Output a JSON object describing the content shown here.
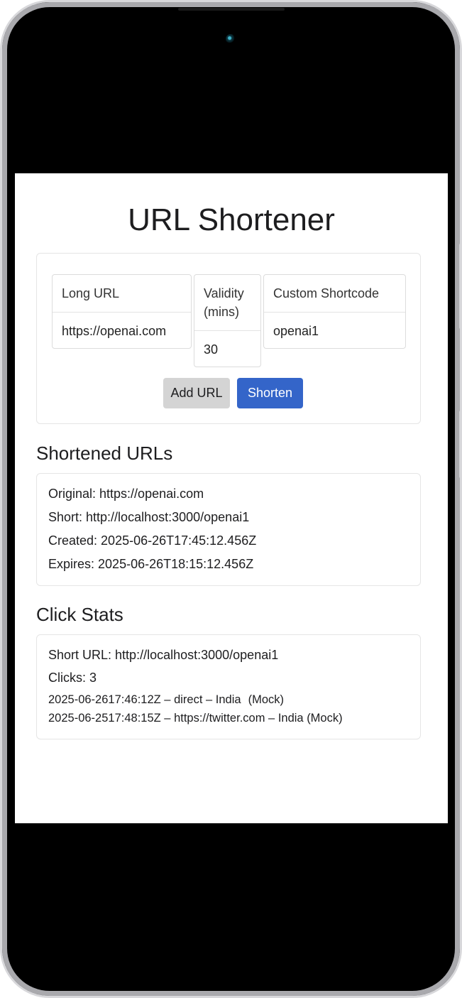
{
  "app": {
    "title": "URL Shortener"
  },
  "form": {
    "fields": [
      {
        "label": "Long URL",
        "value": "https://openai.com"
      },
      {
        "label": "Validity (mins)",
        "value": "30"
      },
      {
        "label": "Custom Shortcode",
        "value": "openai1"
      }
    ],
    "add_button_label": "Add URL",
    "shorten_button_label": "Shorten"
  },
  "shortened": {
    "heading": "Shortened URLs",
    "entry": {
      "original_label": "Original:",
      "original_value": "https://openai.com",
      "short_label": "Short:",
      "short_value": "http://localhost:3000/openai1",
      "created_label": "Created:",
      "created_value": "2025-06-26T17:45:12.456Z",
      "expires_label": "Expires:",
      "expires_value": "2025-06-26T18:15:12.456Z"
    }
  },
  "stats": {
    "heading": "Click Stats",
    "short_url_label": "Short URL:",
    "short_url_value": "http://localhost:3000/openai1",
    "clicks_label": "Clicks:",
    "clicks_value": "3",
    "clicks": [
      {
        "time": "2025-06-2617:46:12Z",
        "source": "direct",
        "location": "India",
        "note": "(Mock)"
      },
      {
        "time": "2025-06-2517:48:15Z",
        "source": "https://twitter.com",
        "location": "India",
        "note": "(Mock)"
      }
    ]
  },
  "colors": {
    "primary": "#3465c9",
    "secondary_button": "#d4d4d4",
    "text": "#1d1d1f",
    "border": "#e5e5e5"
  }
}
